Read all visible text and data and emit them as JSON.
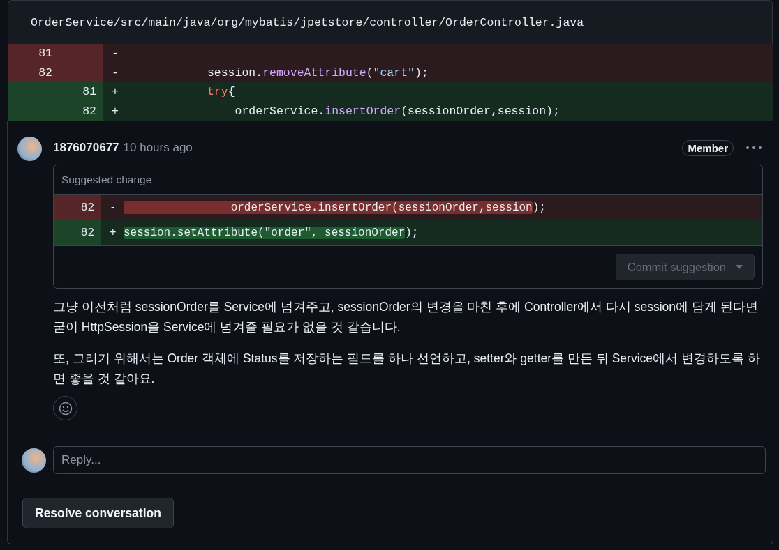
{
  "file_path": "OrderService/src/main/java/org/mybatis/jpetstore/controller/OrderController.java",
  "diff_lines": [
    {
      "kind": "del",
      "old": "81",
      "sign": "-"
    },
    {
      "kind": "del",
      "old": "82",
      "sign": "-",
      "code": [
        {
          "text": "session.",
          "kind": "plain"
        },
        {
          "text": "removeAttribute",
          "kind": "method"
        },
        {
          "text": "(",
          "kind": "plain"
        },
        {
          "text": "\"cart\"",
          "kind": "string"
        },
        {
          "text": ");",
          "kind": "plain"
        }
      ]
    },
    {
      "kind": "add",
      "new": "81",
      "sign": "+",
      "code": [
        {
          "text": "try",
          "kind": "keyword"
        },
        {
          "text": "{",
          "kind": "plain"
        }
      ]
    },
    {
      "kind": "add",
      "new": "82",
      "sign": "+",
      "code": [
        {
          "text": "    orderService.",
          "kind": "plain"
        },
        {
          "text": "insertOrder",
          "kind": "method"
        },
        {
          "text": "(sessionOrder,session);",
          "kind": "plain"
        }
      ]
    }
  ],
  "comment": {
    "author": "1876070677",
    "time": "10 hours ago",
    "badge": "Member",
    "suggestion": {
      "title": "Suggested change",
      "lines": [
        {
          "kind": "del",
          "number": "82",
          "sign": "-",
          "code": [
            {
              "text": "                orderService.insertOrder(sessionOrder,session",
              "highlight": true
            },
            {
              "text": ");",
              "highlight": false
            }
          ]
        },
        {
          "kind": "add",
          "number": "82",
          "sign": "+",
          "code": [
            {
              "text": "session.setAttribute(\"order\", sessionOrder",
              "highlight": true
            },
            {
              "text": ");",
              "highlight": false
            }
          ]
        }
      ],
      "commit_button": {
        "label": "Commit suggestion",
        "disabled": true
      }
    },
    "paragraphs": [
      "그냥 이전처럼 sessionOrder를 Service에 넘겨주고, sessionOrder의 변경을 마친 후에 Controller에서 다시 session에 담게 된다면 굳이 HttpSession을 Service에 넘겨줄 필요가 없을 것 같습니다.",
      "또, 그러기 위해서는 Order 객체에 Status를 저장하는 필드를 하나 선언하고, setter와 getter를 만든 뒤 Service에서 변경하도록 하면 좋을 것 같아요."
    ]
  },
  "reply": {
    "placeholder": "Reply..."
  },
  "resolve_button": "Resolve conversation"
}
